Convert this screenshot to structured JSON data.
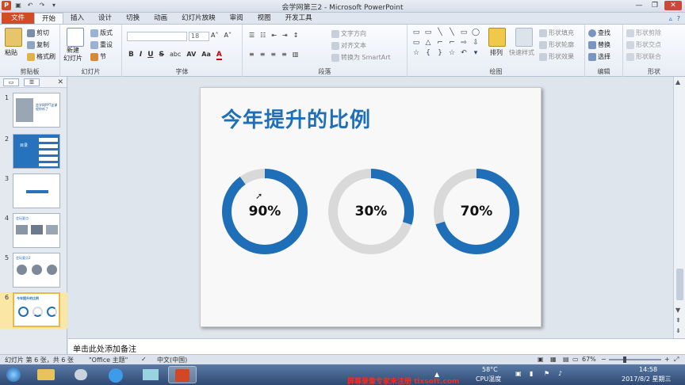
{
  "window": {
    "title": "会学网第三2 - Microsoft PowerPoint",
    "controls": [
      "minimize",
      "maximize",
      "close"
    ]
  },
  "ribbon_tabs": [
    "文件",
    "开始",
    "插入",
    "设计",
    "切换",
    "动画",
    "幻灯片放映",
    "审阅",
    "视图",
    "开发工具"
  ],
  "active_tab": "开始",
  "clipboard": {
    "paste": "粘贴",
    "cut": "剪切",
    "copy": "复制",
    "format_painter": "格式刷",
    "label": "剪贴板"
  },
  "slides_group": {
    "new_slide": "新建\n幻灯片",
    "layout": "版式",
    "reset": "重设",
    "section": "节",
    "label": "幻灯片"
  },
  "font_group": {
    "font_name": "",
    "font_size": "18",
    "label": "字体",
    "buttons": [
      "B",
      "I",
      "U",
      "S",
      "abc",
      "AV",
      "Aa",
      "A"
    ]
  },
  "paragraph_group": {
    "text_direction": "文字方向",
    "align_text": "对齐文本",
    "smartart": "转换为 SmartArt",
    "label": "段落"
  },
  "drawing_group": {
    "arrange": "排列",
    "quick_styles": "快速样式",
    "shape_fill": "形状填充",
    "shape_outline": "形状轮廓",
    "shape_effects": "形状效果",
    "label": "绘图"
  },
  "editing_group": {
    "find": "查找",
    "replace": "替换",
    "select": "选择",
    "label": "编辑"
  },
  "shapes_group": {
    "shape_cut": "形状剪除",
    "shape_intersect": "形状交点",
    "shape_union": "形状联合",
    "label": "形状"
  },
  "thumbnails": [
    {
      "number": "1",
      "caption": "会学网PPT这课程你听了"
    },
    {
      "number": "2",
      "caption": "目录"
    },
    {
      "number": "3",
      "caption": ""
    },
    {
      "number": "4",
      "caption": "会玩要点"
    },
    {
      "number": "5",
      "caption": "会玩要点2"
    },
    {
      "number": "6",
      "caption": "今年提升的比例"
    }
  ],
  "selected_slide": 6,
  "slide": {
    "title": "今年提升的比例",
    "rings": [
      {
        "label": "90%",
        "value": 0.9
      },
      {
        "label": "30%",
        "value": 0.3
      },
      {
        "label": "70%",
        "value": 0.7
      }
    ],
    "colors": {
      "accent": "#1e6fb8",
      "track": "#d9d9d9",
      "title": "#1e6fb8"
    }
  },
  "notes_placeholder": "单击此处添加备注",
  "statusbar": {
    "slide_info": "幻灯片 第 6 张，共 6 张",
    "theme": "\"Office 主题\"",
    "language": "中文(中国)",
    "zoom": "67%"
  },
  "taskbar": {
    "temp": "58°C",
    "cpu": "CPU温度",
    "time": "14:58",
    "date": "2017/8/2 星期三",
    "watermark": "屏幕录像专家未注册 tlxsoft.com"
  }
}
